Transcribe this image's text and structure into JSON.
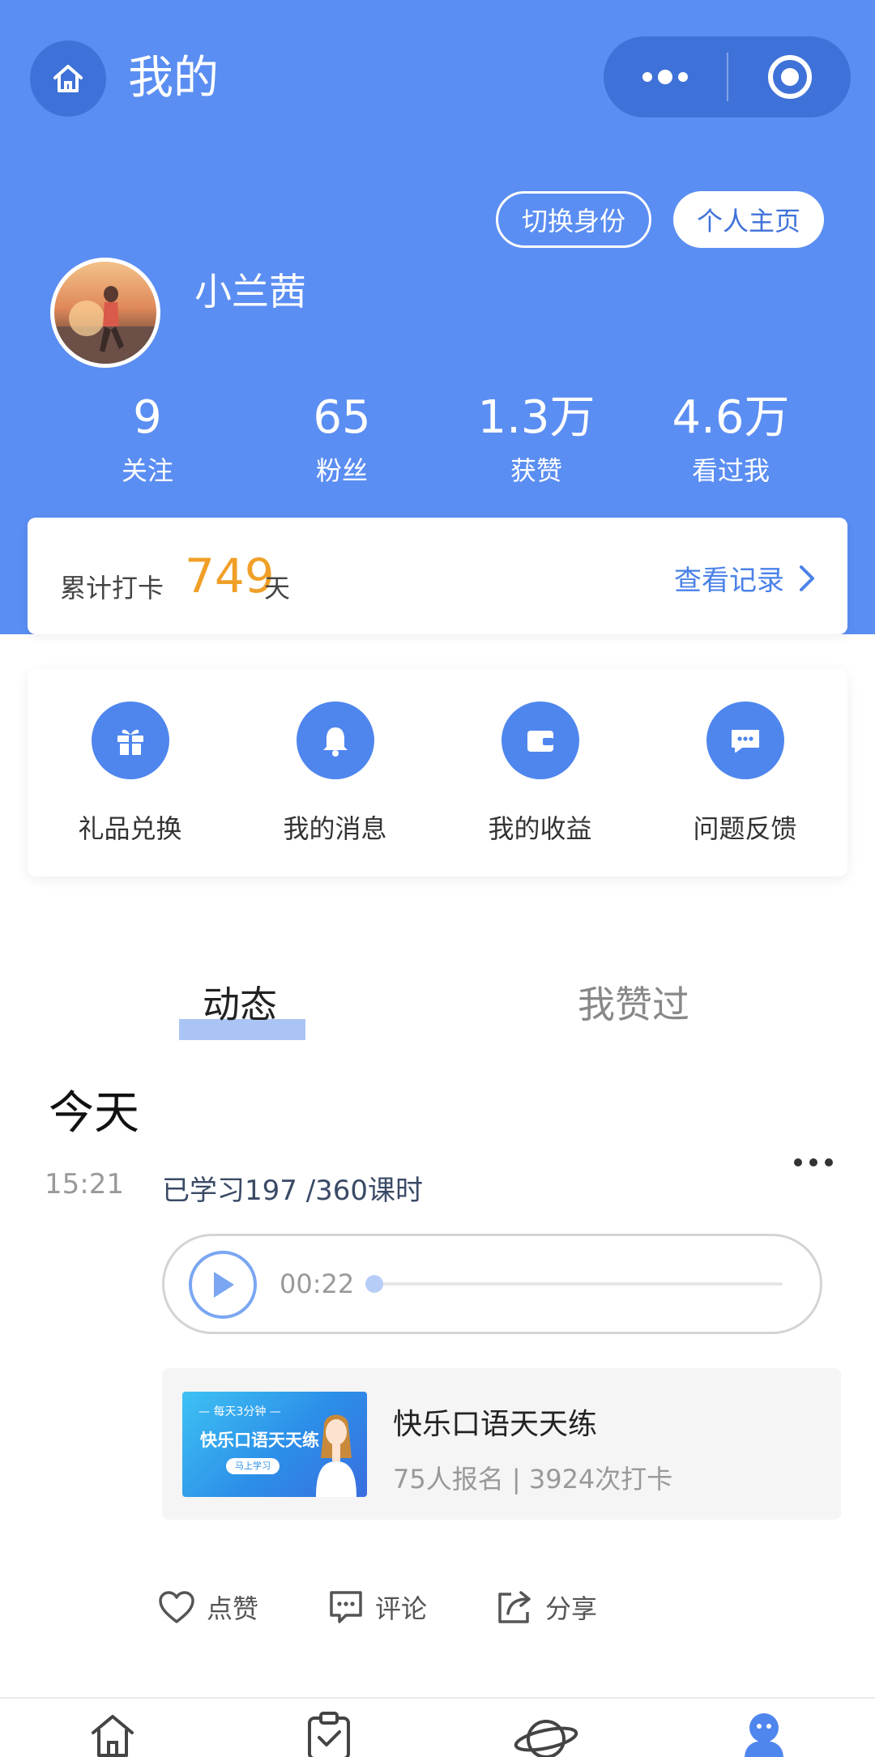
{
  "nav": {
    "title": "我的"
  },
  "profile": {
    "switch_label": "切换身份",
    "home_label": "个人主页",
    "name": "小兰茜"
  },
  "stats": [
    {
      "value": "9",
      "label": "关注"
    },
    {
      "value": "65",
      "label": "粉丝"
    },
    {
      "value": "1.3万",
      "label": "获赞"
    },
    {
      "value": "4.6万",
      "label": "看过我"
    }
  ],
  "checkin": {
    "label": "累计打卡",
    "days": "749",
    "unit": "天",
    "link": "查看记录"
  },
  "quick_actions": [
    {
      "label": "礼品兑换",
      "icon": "gift-icon"
    },
    {
      "label": "我的消息",
      "icon": "bell-icon"
    },
    {
      "label": "我的收益",
      "icon": "wallet-icon"
    },
    {
      "label": "问题反馈",
      "icon": "chat-bubble-icon"
    }
  ],
  "tabs": {
    "active": "动态",
    "inactive": "我赞过"
  },
  "feed": {
    "day": "今天",
    "time": "15:21",
    "text": "已学习197 /360课时",
    "audio_time": "00:22",
    "audio_progress": 0,
    "course": {
      "title": "快乐口语天天练",
      "meta": "75人报名 | 3924次打卡",
      "thumb_top": "— 每天3分钟 —",
      "thumb_title": "快乐口语天天练",
      "thumb_button": "马上学习"
    },
    "actions": [
      {
        "label": "点赞",
        "icon": "heart-icon"
      },
      {
        "label": "评论",
        "icon": "comment-icon"
      },
      {
        "label": "分享",
        "icon": "share-icon"
      }
    ]
  },
  "colors": {
    "brand_blue": "#5b8ef2",
    "accent_orange": "#f0a028",
    "link_blue": "#4a82e8"
  },
  "tabbar": [
    {
      "icon": "home-icon",
      "active": false
    },
    {
      "icon": "clipboard-check-icon",
      "active": false
    },
    {
      "icon": "planet-icon",
      "active": false
    },
    {
      "icon": "profile-icon",
      "active": true
    }
  ]
}
